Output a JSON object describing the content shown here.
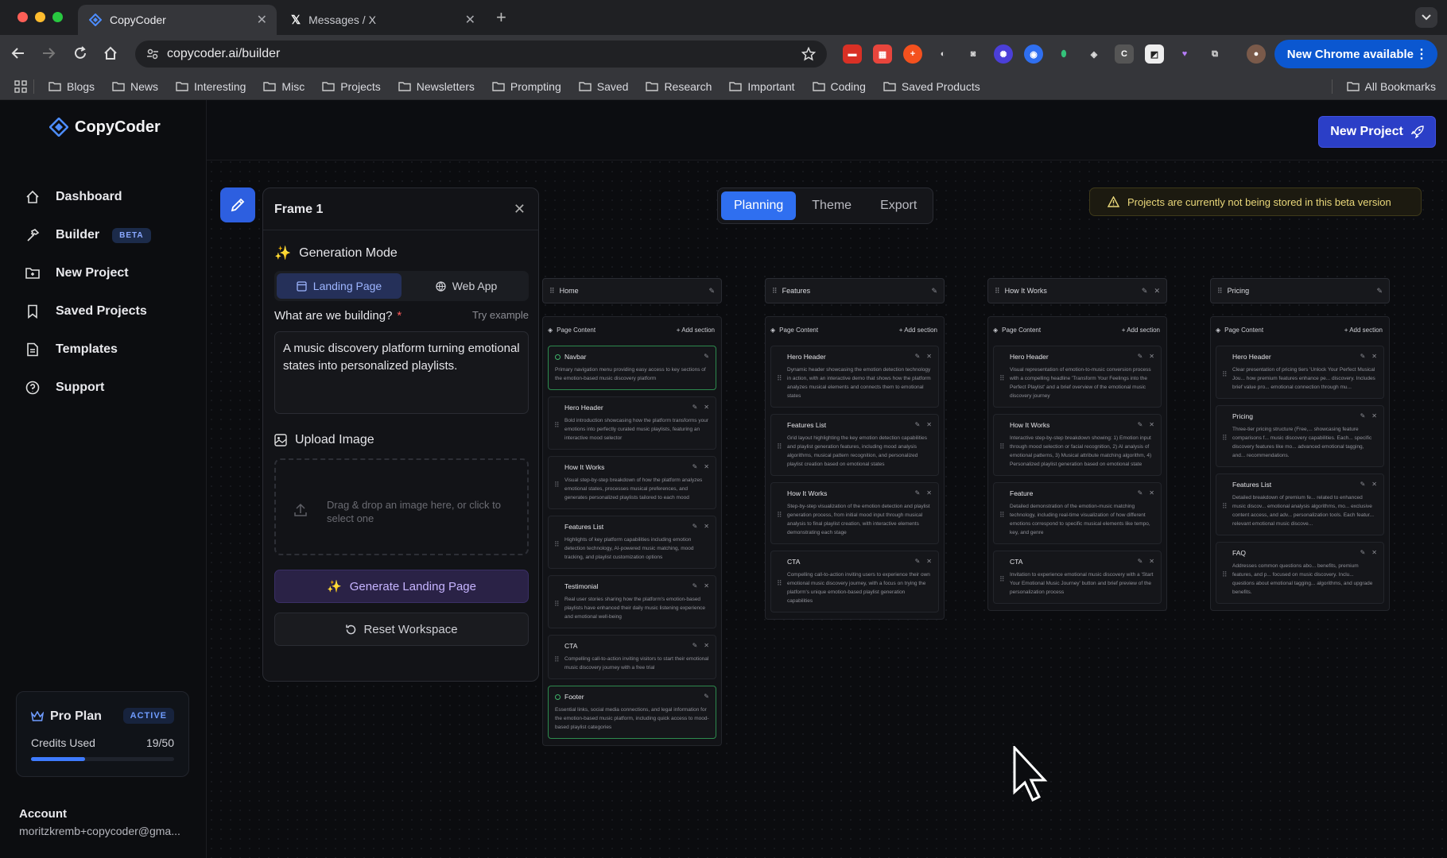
{
  "browser": {
    "tabs": [
      {
        "title": "CopyCoder"
      },
      {
        "title": "Messages / X"
      }
    ],
    "url": "copycoder.ai/builder",
    "update_label": "New Chrome available",
    "bookmarks": [
      "Blogs",
      "News",
      "Interesting",
      "Misc",
      "Projects",
      "Newsletters",
      "Prompting",
      "Saved",
      "Research",
      "Important",
      "Coding",
      "Saved Products"
    ],
    "all_bookmarks": "All Bookmarks"
  },
  "app": {
    "name": "CopyCoder",
    "nav": [
      {
        "label": "Dashboard",
        "icon": "home-icon"
      },
      {
        "label": "Builder",
        "icon": "hammer-icon",
        "badge": "BETA"
      },
      {
        "label": "New Project",
        "icon": "folder-plus-icon"
      },
      {
        "label": "Saved Projects",
        "icon": "bookmark-icon"
      },
      {
        "label": "Templates",
        "icon": "document-icon"
      },
      {
        "label": "Support",
        "icon": "help-icon"
      }
    ],
    "plan": {
      "name": "Pro Plan",
      "status": "ACTIVE",
      "credits_label": "Credits Used",
      "credits_value": "19/50",
      "credits_fraction": 0.38
    },
    "account": {
      "label": "Account",
      "email": "moritzkremb+copycoder@gma..."
    },
    "new_project": "New Project"
  },
  "panel": {
    "title": "Frame 1",
    "generation_mode": "Generation Mode",
    "modes": [
      "Landing Page",
      "Web App"
    ],
    "question": "What are we building?",
    "required": "*",
    "try_example": "Try example",
    "prompt": "A music discovery platform turning emotional states into personalized playlists.",
    "upload_label": "Upload Image",
    "drop_text": "Drag & drop an image here, or click to select one",
    "generate": "Generate Landing Page",
    "reset": "Reset Workspace"
  },
  "view_tabs": [
    "Planning",
    "Theme",
    "Export"
  ],
  "warning": "Projects are currently not being stored in this beta version",
  "page_content_label": "Page Content",
  "add_section_label": "Add section",
  "pages": [
    {
      "name": "Home",
      "sections": [
        {
          "title": "Navbar",
          "desc": "Primary navigation menu providing easy access to key sections of the emotion-based music discovery platform",
          "green": true
        },
        {
          "title": "Hero Header",
          "desc": "Bold introduction showcasing how the platform transforms your emotions into perfectly curated music playlists, featuring an interactive mood selector"
        },
        {
          "title": "How It Works",
          "desc": "Visual step-by-step breakdown of how the platform analyzes emotional states, processes musical preferences, and generates personalized playlists tailored to each mood"
        },
        {
          "title": "Features List",
          "desc": "Highlights of key platform capabilities including emotion detection technology, AI-powered music matching, mood tracking, and playlist customization options"
        },
        {
          "title": "Testimonial",
          "desc": "Real user stories sharing how the platform's emotion-based playlists have enhanced their daily music listening experience and emotional well-being"
        },
        {
          "title": "CTA",
          "desc": "Compelling call-to-action inviting visitors to start their emotional music discovery journey with a free trial"
        },
        {
          "title": "Footer",
          "desc": "Essential links, social media connections, and legal information for the emotion-based music platform, including quick access to mood-based playlist categories",
          "green": true
        }
      ]
    },
    {
      "name": "Features",
      "sections": [
        {
          "title": "Hero Header",
          "desc": "Dynamic header showcasing the emotion detection technology in action, with an interactive demo that shows how the platform analyzes musical elements and connects them to emotional states"
        },
        {
          "title": "Features List",
          "desc": "Grid layout highlighting the key emotion detection capabilities and playlist generation features, including mood analysis algorithms, musical pattern recognition, and personalized playlist creation based on emotional states"
        },
        {
          "title": "How It Works",
          "desc": "Step-by-step visualization of the emotion detection and playlist generation process, from initial mood input through musical analysis to final playlist creation, with interactive elements demonstrating each stage"
        },
        {
          "title": "CTA",
          "desc": "Compelling call-to-action inviting users to experience their own emotional music discovery journey, with a focus on trying the platform's unique emotion-based playlist generation capabilities"
        }
      ]
    },
    {
      "name": "How It Works",
      "sections": [
        {
          "title": "Hero Header",
          "desc": "Visual representation of emotion-to-music conversion process with a compelling headline 'Transform Your Feelings into the Perfect Playlist' and a brief overview of the emotional music discovery journey"
        },
        {
          "title": "How It Works",
          "desc": "Interactive step-by-step breakdown showing: 1) Emotion input through mood selection or facial recognition, 2) AI analysis of emotional patterns, 3) Musical attribute matching algorithm, 4) Personalized playlist generation based on emotional state"
        },
        {
          "title": "Feature",
          "desc": "Detailed demonstration of the emotion-music matching technology, including real-time visualization of how different emotions correspond to specific musical elements like tempo, key, and genre"
        },
        {
          "title": "CTA",
          "desc": "Invitation to experience emotional music discovery with a 'Start Your Emotional Music Journey' button and brief preview of the personalization process"
        }
      ]
    },
    {
      "name": "Pricing",
      "sections": [
        {
          "title": "Hero Header",
          "desc": "Clear presentation of pricing tiers 'Unlock Your Perfect Musical Jou... how premium features enhance pe... discovery. Includes brief value pro... emotional connection through mu..."
        },
        {
          "title": "Pricing",
          "desc": "Three-tier pricing structure (Free,... showcasing feature comparisons f... music discovery capabilities. Each... specific discovery features like mo... advanced emotional tagging, and... recommendations."
        },
        {
          "title": "Features List",
          "desc": "Detailed breakdown of premium fe... related to enhanced music discov... emotional analysis algorithms, mo... exclusive content access, and adv... personalization tools. Each featur... relevant emotional music discove..."
        },
        {
          "title": "FAQ",
          "desc": "Addresses common questions abo... benefits, premium features, and p... focused on music discovery. Inclu... questions about emotional tagging... algorithms, and upgrade benefits."
        }
      ]
    }
  ]
}
